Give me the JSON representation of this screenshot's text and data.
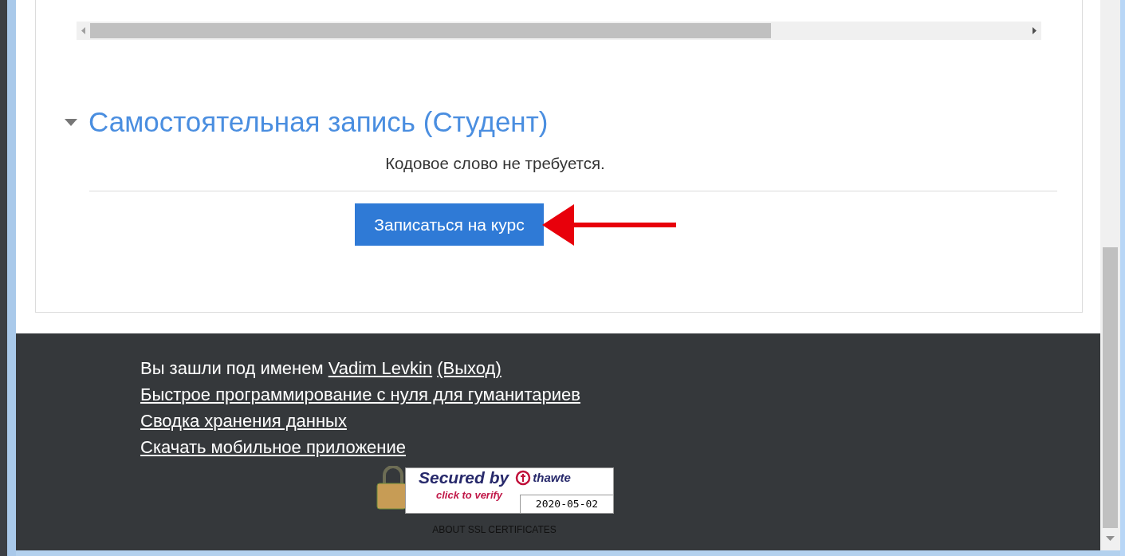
{
  "section": {
    "title": "Самостоятельная запись (Студент)",
    "expanded": true,
    "message": "Кодовое слово не требуется.",
    "button": "Записаться на курс"
  },
  "footer": {
    "login": {
      "prefix": "Вы зашли под именем",
      "user": "Vadim Levkin",
      "logout": "(Выход)"
    },
    "links": [
      "Быстрое программирование с нуля для гуманитариев",
      "Сводка хранения данных",
      "Скачать мобильное приложение"
    ],
    "badge": {
      "title": "Secured by",
      "subtitle": "click to verify",
      "brand": "thawte",
      "date": "2020-05-02"
    },
    "about": "ABOUT SSL CERTIFICATES"
  }
}
